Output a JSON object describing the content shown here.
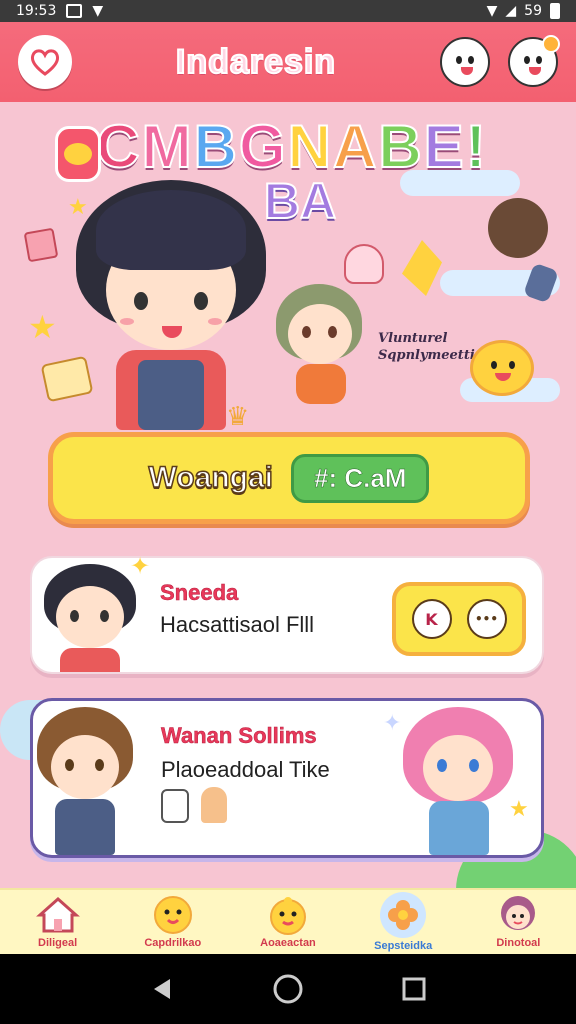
{
  "status_bar": {
    "time": "19:53",
    "battery_text": "59"
  },
  "header": {
    "title": "Indaresin"
  },
  "hero": {
    "title_letters": [
      {
        "ch": "C",
        "color": "#e94a7a"
      },
      {
        "ch": "M",
        "color": "#f06aa0"
      },
      {
        "ch": "B",
        "color": "#5aa8f0"
      },
      {
        "ch": "G",
        "color": "#f05aa0"
      },
      {
        "ch": "N",
        "color": "#ffd23f"
      },
      {
        "ch": "A",
        "color": "#f7a04a"
      },
      {
        "ch": "B",
        "color": "#7ccf5c"
      },
      {
        "ch": "E",
        "color": "#a37be0"
      },
      {
        "ch": "!",
        "color": "#5fc15a"
      }
    ],
    "subtitle": "BA",
    "note_line1": "Vlunturel",
    "note_line2": "Sqpnlymeettin"
  },
  "welcome": {
    "label": "Woangai",
    "code": "#: C.aM"
  },
  "cards": [
    {
      "title": "Sneeda",
      "subtitle": "Hacsattisaol Flll",
      "buttons": [
        "K",
        "•••"
      ]
    },
    {
      "title": "Wanan Sollims",
      "subtitle": "Plaoeaddoal Tike"
    }
  ],
  "bottom_nav": [
    {
      "label": "Diligeal",
      "icon": "home-icon"
    },
    {
      "label": "Capdrilkao",
      "icon": "chick-face-icon"
    },
    {
      "label": "Aoaeactan",
      "icon": "duck-face-icon"
    },
    {
      "label": "Sepsteidka",
      "icon": "flower-icon",
      "active": true
    },
    {
      "label": "Dinotoal",
      "icon": "girl-avatar-icon"
    }
  ],
  "colors": {
    "header": "#f36070",
    "accent_yellow": "#fbe44a",
    "accent_green": "#5fc15a",
    "accent_pink": "#e8385a"
  }
}
